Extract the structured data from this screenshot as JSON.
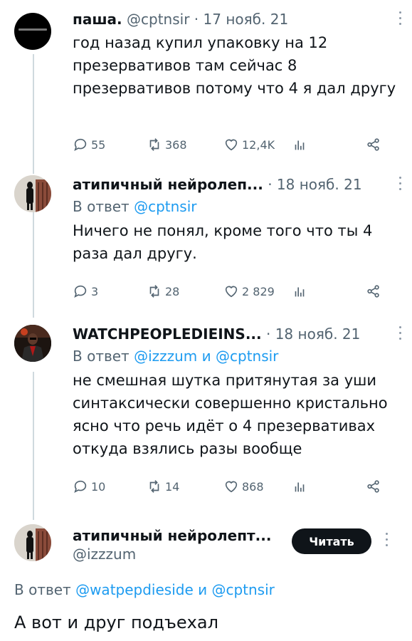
{
  "tweets": [
    {
      "name": "паша.",
      "handle": "@cptnsir",
      "date": "17 нояб. 21",
      "reply_to": null,
      "text": "год назад купил упаковку на 12 презервативов там сейчас 8 презервативов потому что 4 я дал другу",
      "replies": "55",
      "retweets": "368",
      "likes": "12,4K"
    },
    {
      "name": "атипичный нейролеп...",
      "handle": "",
      "date": "18 нояб. 21",
      "reply_prefix": "В ответ",
      "reply_links": "@cptnsir",
      "text": "Ничего не понял, кроме того что ты 4 раза дал другу.",
      "replies": "3",
      "retweets": "28",
      "likes": "2 829"
    },
    {
      "name": "WATCHPEOPLEDIEINS...",
      "handle": "",
      "date": "18 нояб. 21",
      "reply_prefix": "В ответ",
      "reply_links": "@izzzum и @cptnsir",
      "text": "не смешная шутка притянутая за уши синтаксически совершенно кристально ясно что речь идёт о 4 презервативах откуда взялись разы вообще",
      "replies": "10",
      "retweets": "14",
      "likes": "868"
    }
  ],
  "main_tweet": {
    "name": "атипичный нейролепт...",
    "handle": "@izzzum",
    "follow_label": "Читать",
    "reply_prefix": "В ответ",
    "reply_links": "@watpepdieside и @cptnsir",
    "text": "А вот и друг подъехал"
  },
  "sep": "·",
  "icons": [
    "reply-icon",
    "retweet-icon",
    "like-icon",
    "views-icon",
    "share-icon",
    "more-icon"
  ],
  "colors": {
    "link": "#1d9bf0",
    "muted": "#536471",
    "text": "#0f1419"
  }
}
